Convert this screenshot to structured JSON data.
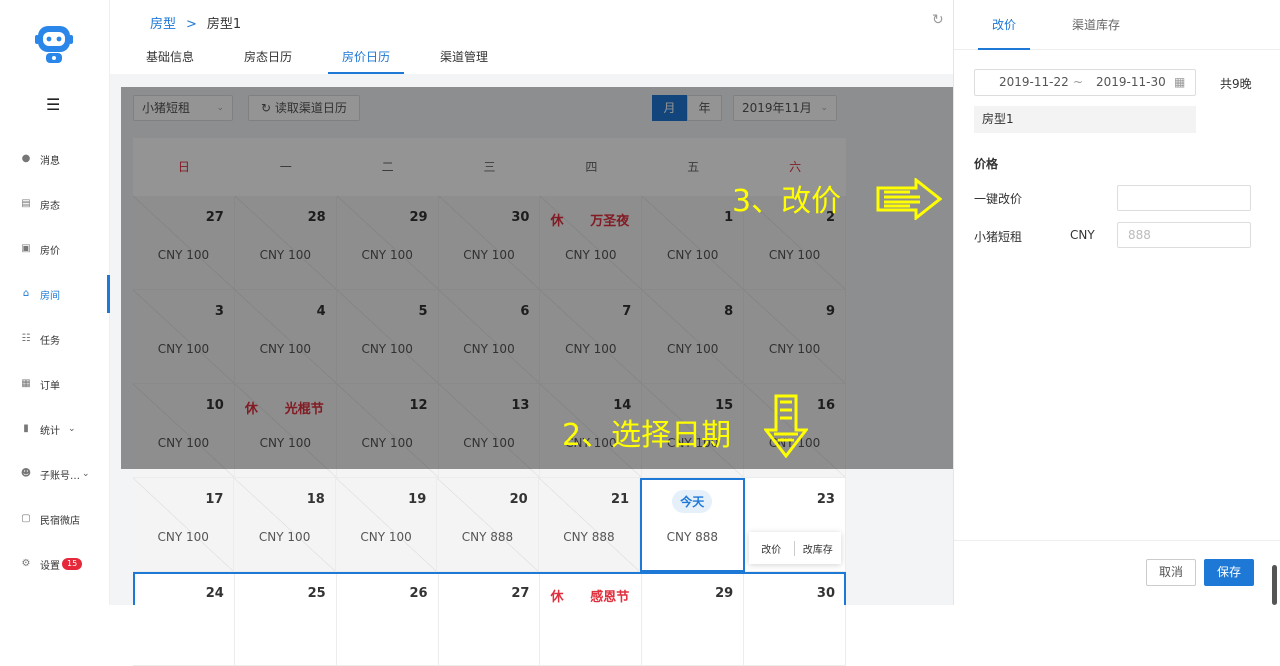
{
  "sidebar": {
    "items": [
      {
        "label": "消息",
        "icon": "message-icon"
      },
      {
        "label": "房态",
        "icon": "room-status-icon"
      },
      {
        "label": "房价",
        "icon": "room-price-icon"
      },
      {
        "label": "房间",
        "icon": "home-icon",
        "active": true
      },
      {
        "label": "任务",
        "icon": "task-icon"
      },
      {
        "label": "订单",
        "icon": "order-icon"
      },
      {
        "label": "统计",
        "icon": "chart-icon"
      },
      {
        "label": "子账号…",
        "icon": "users-icon"
      },
      {
        "label": "民宿微店",
        "icon": "shop-icon"
      },
      {
        "label": "设置",
        "icon": "gear-icon",
        "badge": "15"
      }
    ]
  },
  "breadcrumb": {
    "parent": "房型",
    "sep": ">",
    "current": "房型1"
  },
  "tabs": [
    "基础信息",
    "房态日历",
    "房价日历",
    "渠道管理"
  ],
  "toolbar": {
    "channel": "小猪短租",
    "sync_label": "读取渠道日历",
    "view_month": "月",
    "view_year": "年",
    "month_select": "2019年11月"
  },
  "calendar": {
    "weekdays": [
      "日",
      "一",
      "二",
      "三",
      "四",
      "五",
      "六"
    ],
    "rows": [
      [
        {
          "d": "27",
          "p": "CNY 100",
          "past": true
        },
        {
          "d": "28",
          "p": "CNY 100",
          "past": true
        },
        {
          "d": "29",
          "p": "CNY 100",
          "past": true
        },
        {
          "d": "30",
          "p": "CNY 100",
          "past": true
        },
        {
          "hol": "休",
          "d": "万圣夜",
          "p": "CNY 100",
          "past": true
        },
        {
          "d": "1",
          "p": "CNY 100",
          "past": true
        },
        {
          "d": "2",
          "p": "CNY 100",
          "past": true
        }
      ],
      [
        {
          "d": "3",
          "p": "CNY 100",
          "past": true
        },
        {
          "d": "4",
          "p": "CNY 100",
          "past": true
        },
        {
          "d": "5",
          "p": "CNY 100",
          "past": true
        },
        {
          "d": "6",
          "p": "CNY 100",
          "past": true
        },
        {
          "d": "7",
          "p": "CNY 100",
          "past": true
        },
        {
          "d": "8",
          "p": "CNY 100",
          "past": true
        },
        {
          "d": "9",
          "p": "CNY 100",
          "past": true
        }
      ],
      [
        {
          "d": "10",
          "p": "CNY 100",
          "past": true
        },
        {
          "hol": "休",
          "d": "光棍节",
          "p": "CNY 100",
          "past": true
        },
        {
          "d": "12",
          "p": "CNY 100",
          "past": true
        },
        {
          "d": "13",
          "p": "CNY 100",
          "past": true
        },
        {
          "d": "14",
          "p": "CNY 100",
          "past": true
        },
        {
          "d": "15",
          "p": "CNY 100",
          "past": true
        },
        {
          "d": "16",
          "p": "CNY 100",
          "past": true
        }
      ],
      [
        {
          "d": "17",
          "p": "CNY 100",
          "past": true
        },
        {
          "d": "18",
          "p": "CNY 100",
          "past": true
        },
        {
          "d": "19",
          "p": "CNY 100",
          "past": true
        },
        {
          "d": "20",
          "p": "CNY 888",
          "past": true
        },
        {
          "d": "21",
          "p": "CNY 888",
          "past": true
        },
        {
          "today": "今天",
          "p": "CNY 888"
        },
        {
          "d": "23",
          "popover": true
        }
      ],
      [
        {
          "d": "24"
        },
        {
          "d": "25"
        },
        {
          "d": "26"
        },
        {
          "d": "27"
        },
        {
          "hol": "休",
          "d": "感恩节"
        },
        {
          "d": "29"
        },
        {
          "d": "30"
        }
      ]
    ],
    "popover": {
      "edit_price": "改价",
      "edit_stock": "改库存"
    }
  },
  "annotations": {
    "step3": "3、改价",
    "step2": "2、选择日期"
  },
  "panel": {
    "tabs": [
      "改价",
      "渠道库存"
    ],
    "date_start": "2019-11-22",
    "date_sep": "~",
    "date_end": "2019-11-30",
    "nights": "共9晚",
    "room": "房型1",
    "section": "价格",
    "bulk_label": "一键改价",
    "channel_label": "小猪短租",
    "currency": "CNY",
    "price_placeholder": "888",
    "cancel": "取消",
    "save": "保存"
  },
  "colors": {
    "accent": "#1e78d6",
    "holiday": "#e0303e",
    "annotation": "#ffff00",
    "badge": "#e5293b"
  }
}
